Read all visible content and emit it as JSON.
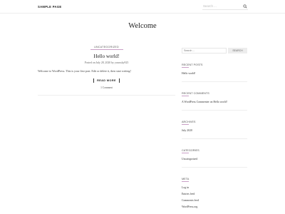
{
  "nav": {
    "sample_page": "SAMPLE PAGE"
  },
  "search": {
    "placeholder": "Search ..."
  },
  "site": {
    "title": "Welcome"
  },
  "post": {
    "category": "UNCATEGORIZED",
    "title": "Hello world!",
    "meta": "Posted on July 28, 2020  by yuwusky925",
    "excerpt": "Welcome to WordPress. This is your first post. Edit or delete it, then start writing!",
    "read_more": "READ MORE",
    "comments": "1 Comment"
  },
  "sidebar": {
    "search_placeholder": "Search ...",
    "search_button": "SEARCH",
    "recent_posts": {
      "title": "RECENT POSTS",
      "items": [
        "Hello world!"
      ]
    },
    "recent_comments": {
      "title": "RECENT COMMENTS",
      "items": [
        "A WordPress Commenter on Hello world!"
      ]
    },
    "archives": {
      "title": "ARCHIVES",
      "items": [
        "July 2020"
      ]
    },
    "categories": {
      "title": "CATEGORIES",
      "items": [
        "Uncategorized"
      ]
    },
    "meta": {
      "title": "META",
      "items": [
        "Log in",
        "Entries feed",
        "Comments feed",
        "WordPress.org"
      ]
    }
  },
  "icons": {
    "search": "search-icon"
  },
  "colors": {
    "accent": "#c9a0c6"
  }
}
